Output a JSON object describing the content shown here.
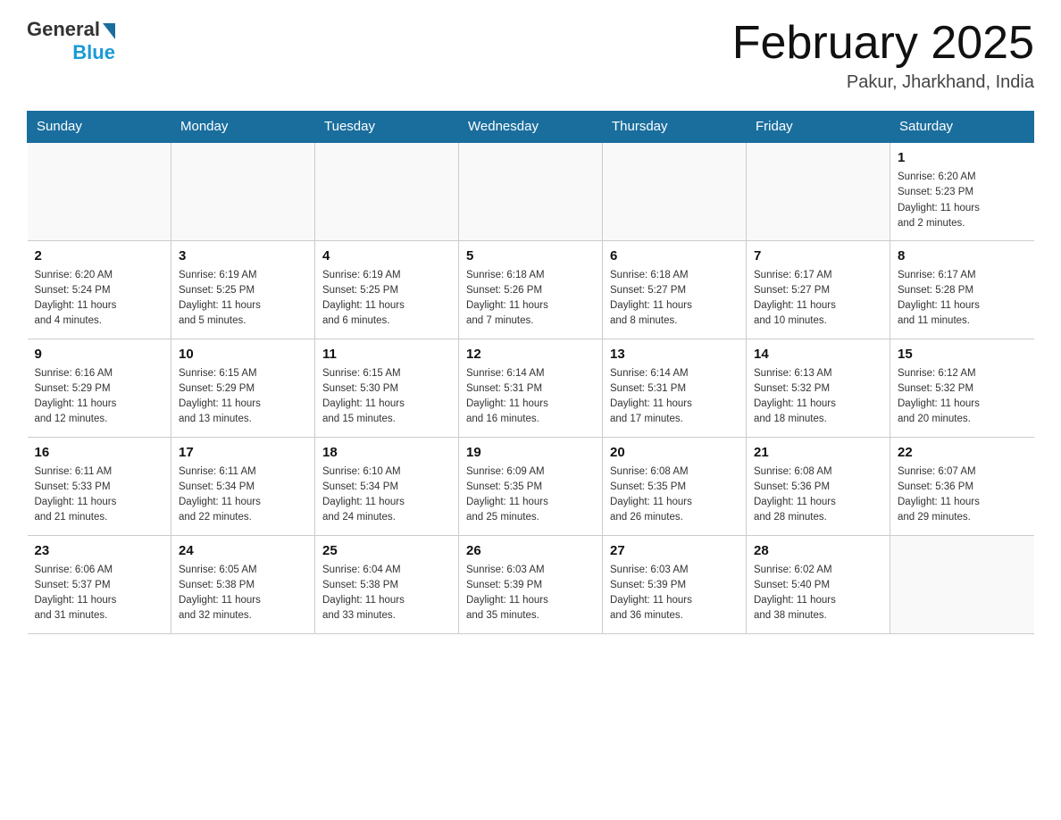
{
  "header": {
    "logo_general": "General",
    "logo_blue": "Blue",
    "title": "February 2025",
    "subtitle": "Pakur, Jharkhand, India"
  },
  "days_of_week": [
    "Sunday",
    "Monday",
    "Tuesday",
    "Wednesday",
    "Thursday",
    "Friday",
    "Saturday"
  ],
  "weeks": [
    [
      {
        "day": "",
        "info": ""
      },
      {
        "day": "",
        "info": ""
      },
      {
        "day": "",
        "info": ""
      },
      {
        "day": "",
        "info": ""
      },
      {
        "day": "",
        "info": ""
      },
      {
        "day": "",
        "info": ""
      },
      {
        "day": "1",
        "info": "Sunrise: 6:20 AM\nSunset: 5:23 PM\nDaylight: 11 hours\nand 2 minutes."
      }
    ],
    [
      {
        "day": "2",
        "info": "Sunrise: 6:20 AM\nSunset: 5:24 PM\nDaylight: 11 hours\nand 4 minutes."
      },
      {
        "day": "3",
        "info": "Sunrise: 6:19 AM\nSunset: 5:25 PM\nDaylight: 11 hours\nand 5 minutes."
      },
      {
        "day": "4",
        "info": "Sunrise: 6:19 AM\nSunset: 5:25 PM\nDaylight: 11 hours\nand 6 minutes."
      },
      {
        "day": "5",
        "info": "Sunrise: 6:18 AM\nSunset: 5:26 PM\nDaylight: 11 hours\nand 7 minutes."
      },
      {
        "day": "6",
        "info": "Sunrise: 6:18 AM\nSunset: 5:27 PM\nDaylight: 11 hours\nand 8 minutes."
      },
      {
        "day": "7",
        "info": "Sunrise: 6:17 AM\nSunset: 5:27 PM\nDaylight: 11 hours\nand 10 minutes."
      },
      {
        "day": "8",
        "info": "Sunrise: 6:17 AM\nSunset: 5:28 PM\nDaylight: 11 hours\nand 11 minutes."
      }
    ],
    [
      {
        "day": "9",
        "info": "Sunrise: 6:16 AM\nSunset: 5:29 PM\nDaylight: 11 hours\nand 12 minutes."
      },
      {
        "day": "10",
        "info": "Sunrise: 6:15 AM\nSunset: 5:29 PM\nDaylight: 11 hours\nand 13 minutes."
      },
      {
        "day": "11",
        "info": "Sunrise: 6:15 AM\nSunset: 5:30 PM\nDaylight: 11 hours\nand 15 minutes."
      },
      {
        "day": "12",
        "info": "Sunrise: 6:14 AM\nSunset: 5:31 PM\nDaylight: 11 hours\nand 16 minutes."
      },
      {
        "day": "13",
        "info": "Sunrise: 6:14 AM\nSunset: 5:31 PM\nDaylight: 11 hours\nand 17 minutes."
      },
      {
        "day": "14",
        "info": "Sunrise: 6:13 AM\nSunset: 5:32 PM\nDaylight: 11 hours\nand 18 minutes."
      },
      {
        "day": "15",
        "info": "Sunrise: 6:12 AM\nSunset: 5:32 PM\nDaylight: 11 hours\nand 20 minutes."
      }
    ],
    [
      {
        "day": "16",
        "info": "Sunrise: 6:11 AM\nSunset: 5:33 PM\nDaylight: 11 hours\nand 21 minutes."
      },
      {
        "day": "17",
        "info": "Sunrise: 6:11 AM\nSunset: 5:34 PM\nDaylight: 11 hours\nand 22 minutes."
      },
      {
        "day": "18",
        "info": "Sunrise: 6:10 AM\nSunset: 5:34 PM\nDaylight: 11 hours\nand 24 minutes."
      },
      {
        "day": "19",
        "info": "Sunrise: 6:09 AM\nSunset: 5:35 PM\nDaylight: 11 hours\nand 25 minutes."
      },
      {
        "day": "20",
        "info": "Sunrise: 6:08 AM\nSunset: 5:35 PM\nDaylight: 11 hours\nand 26 minutes."
      },
      {
        "day": "21",
        "info": "Sunrise: 6:08 AM\nSunset: 5:36 PM\nDaylight: 11 hours\nand 28 minutes."
      },
      {
        "day": "22",
        "info": "Sunrise: 6:07 AM\nSunset: 5:36 PM\nDaylight: 11 hours\nand 29 minutes."
      }
    ],
    [
      {
        "day": "23",
        "info": "Sunrise: 6:06 AM\nSunset: 5:37 PM\nDaylight: 11 hours\nand 31 minutes."
      },
      {
        "day": "24",
        "info": "Sunrise: 6:05 AM\nSunset: 5:38 PM\nDaylight: 11 hours\nand 32 minutes."
      },
      {
        "day": "25",
        "info": "Sunrise: 6:04 AM\nSunset: 5:38 PM\nDaylight: 11 hours\nand 33 minutes."
      },
      {
        "day": "26",
        "info": "Sunrise: 6:03 AM\nSunset: 5:39 PM\nDaylight: 11 hours\nand 35 minutes."
      },
      {
        "day": "27",
        "info": "Sunrise: 6:03 AM\nSunset: 5:39 PM\nDaylight: 11 hours\nand 36 minutes."
      },
      {
        "day": "28",
        "info": "Sunrise: 6:02 AM\nSunset: 5:40 PM\nDaylight: 11 hours\nand 38 minutes."
      },
      {
        "day": "",
        "info": ""
      }
    ]
  ]
}
